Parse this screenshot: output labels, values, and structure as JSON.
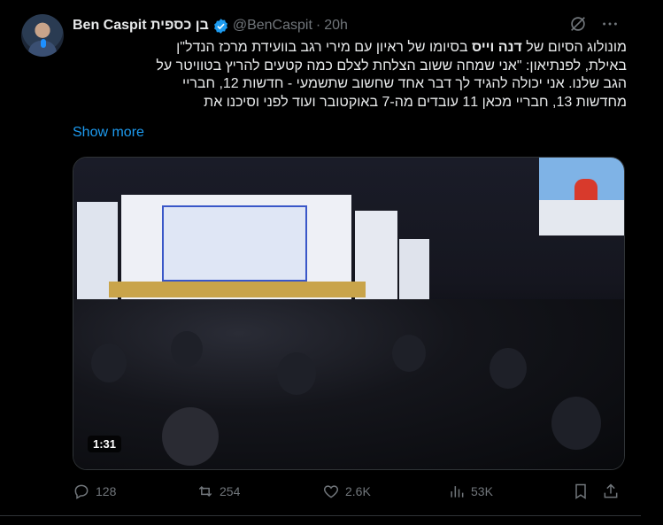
{
  "author": {
    "display_name": "Ben Caspit בן כספית",
    "handle": "@BenCaspit",
    "separator": "·",
    "time": "20h"
  },
  "tweet": {
    "lines": [
      "מונולוג הסיום של דנה וייס בסיומו של ראיון עם מירי רגב בוועידת מרכז הנדל\"ן",
      "באילת, לפנתיאון: \"אני שמחה ששוב הצלחת לצלם כמה קטעים להריץ בטוויטר על",
      "הגב שלנו. אני יכולה להגיד לך דבר אחד שחשוב שתשמעי - חדשות 12, חבריי",
      "מחדשות 13, חבריי מכאן 11 עובדים מה-7 באוקטובר ועוד לפני וסיכנו את"
    ],
    "bold_name": "דנה וייס",
    "show_more": "Show more"
  },
  "media": {
    "duration": "1:31"
  },
  "metrics": {
    "replies": "128",
    "reposts": "254",
    "likes": "2.6K",
    "views": "53K"
  },
  "icons": {
    "verified": "verified-badge-icon",
    "grok": "grok-icon",
    "more": "more-icon",
    "reply": "reply-icon",
    "repost": "repost-icon",
    "like": "heart-icon",
    "views": "views-icon",
    "bookmark": "bookmark-icon",
    "share": "share-icon"
  },
  "colors": {
    "accent": "#1d9bf0",
    "muted": "#71767b",
    "text": "#e7e9ea",
    "background": "#000000"
  }
}
